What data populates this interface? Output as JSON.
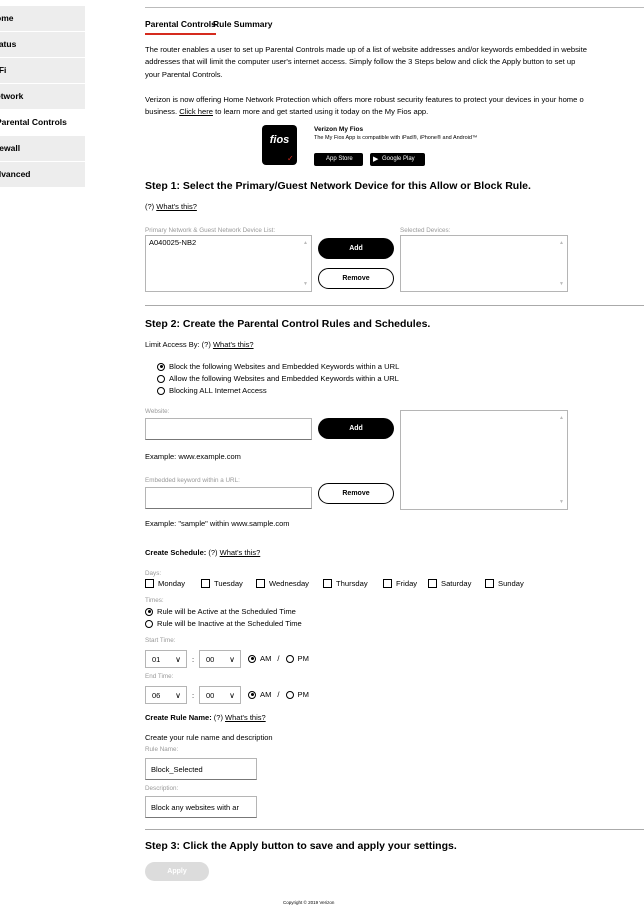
{
  "sidebar": {
    "items": [
      {
        "label": "ome",
        "active": false
      },
      {
        "label": "tatus",
        "active": false
      },
      {
        "label": "-Fi",
        "active": false
      },
      {
        "label": "etwork",
        "active": false
      },
      {
        "label": "Parental Controls",
        "active": true
      },
      {
        "label": "rewall",
        "active": false
      },
      {
        "label": "dvanced",
        "active": false
      }
    ]
  },
  "tabs": [
    "Parental Controls",
    "Rule Summary"
  ],
  "intro": {
    "line1": "The router enables a user to set up Parental Controls made up of a list of website addresses and/or keywords embedded in website",
    "line2": "addresses that will limit the computer user's internet access. Simply follow the 3 Steps below and click the Apply button to set up",
    "line3": "your Parental Controls.",
    "promo_line1": "Verizon is now offering Home Network Protection which offers more robust security features to protect your devices in your home o",
    "promo_pre": "business. ",
    "promo_link": "Click here",
    "promo_post": " to learn more and get started using it today on the My Fios app."
  },
  "app": {
    "logo_text": "fios",
    "title": "Verizon My Fios",
    "desc": "The My Fios App is compatible with iPad®, iPhone® and Android™",
    "app_store": "App Store",
    "google_play": "Google Play"
  },
  "step1": {
    "heading": "Step 1: Select the Primary/Guest Network Device for this Allow or Block Rule.",
    "help_prefix": "(?) ",
    "help_link": "What's this?",
    "device_list_label": "Primary Network & Guest Network Device List:",
    "devices": [
      "A040025-NB2"
    ],
    "selected_label": "Selected Devices:",
    "add": "Add",
    "remove": "Remove"
  },
  "step2": {
    "heading": "Step 2: Create the Parental Control Rules and Schedules.",
    "limit_prefix": "Limit Access By: (?) ",
    "limit_link": "What's this?",
    "options": [
      {
        "label": "Block the following Websites and Embedded Keywords within a URL",
        "selected": true
      },
      {
        "label": "Allow the following Websites and Embedded Keywords within a URL",
        "selected": false
      },
      {
        "label": "Blocking ALL Internet Access",
        "selected": false
      }
    ],
    "website_label": "Website:",
    "website_value": "",
    "add": "Add",
    "website_example": "Example: www.example.com",
    "keyword_label": "Embedded keyword within a URL:",
    "keyword_value": "",
    "remove": "Remove",
    "keyword_example": "Example: \"sample\" within www.sample.com",
    "schedule_label": "Create Schedule:",
    "schedule_help": " (?) ",
    "schedule_link": "What's this?",
    "days_label": "Days:",
    "days": [
      "Monday",
      "Tuesday",
      "Wednesday",
      "Thursday",
      "Friday",
      "Saturday",
      "Sunday"
    ],
    "times_label": "Times:",
    "time_options": [
      {
        "label": "Rule will be Active at the Scheduled Time",
        "selected": true
      },
      {
        "label": "Rule will be Inactive at the Scheduled Time",
        "selected": false
      }
    ],
    "start_label": "Start Time:",
    "start_hour": "01",
    "start_min": "00",
    "end_label": "End Time:",
    "end_hour": "06",
    "end_min": "00",
    "colon": ":",
    "am": "AM",
    "pm": "PM",
    "slash": "/",
    "rule_name_title": "Create Rule Name:",
    "rule_name_help": " (?) ",
    "rule_name_link": "What's this?",
    "rule_desc_intro": "Create your rule name and description",
    "rule_name_label": "Rule Name:",
    "rule_name_value": "Block_Selected",
    "description_label": "Description:",
    "description_value": "Block any websites with ar"
  },
  "step3": {
    "heading": "Step 3: Click the Apply button to save and apply your settings.",
    "apply": "Apply"
  },
  "footer": {
    "copyright": "Copyright © 2019 Verizon"
  }
}
